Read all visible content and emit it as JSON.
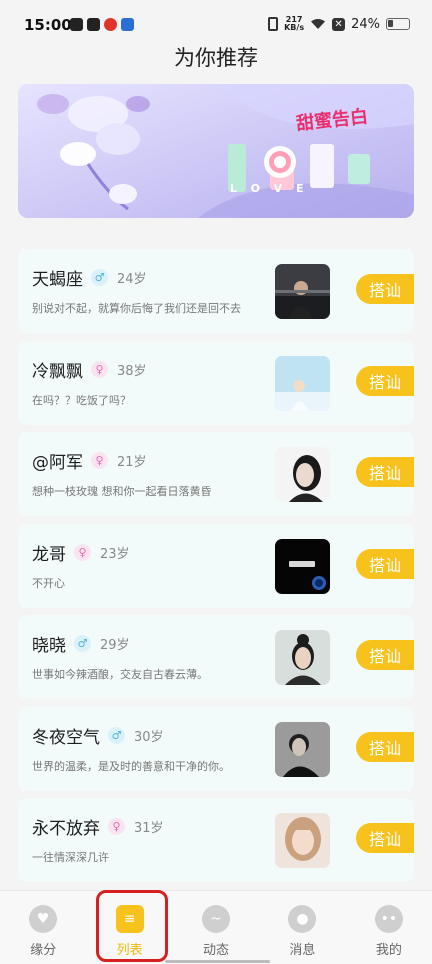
{
  "status_bar": {
    "time": "15:00",
    "net_speed_value": "217",
    "net_speed_unit": "KB/s",
    "battery": "24%"
  },
  "header": {
    "title": "为你推荐"
  },
  "banner": {
    "logo_text": "甜蜜告白",
    "letters": "LOVE"
  },
  "users": [
    {
      "name": "天蝎座",
      "gender": "male",
      "gender_symbol": "♂",
      "age": "24岁",
      "signature": "别说对不起，就算你后悔了我们还是回不去",
      "button": "搭讪"
    },
    {
      "name": "冷飘飘",
      "gender": "female",
      "gender_symbol": "♀",
      "age": "38岁",
      "signature": "在吗？？吃饭了吗？",
      "button": "搭讪"
    },
    {
      "name": "@阿军",
      "gender": "female",
      "gender_symbol": "♀",
      "age": "21岁",
      "signature": "想种一枝玫瑰 想和你一起看日落黄昏",
      "button": "搭讪"
    },
    {
      "name": "龙哥",
      "gender": "female",
      "gender_symbol": "♀",
      "age": "23岁",
      "signature": "不开心",
      "button": "搭讪"
    },
    {
      "name": "晓晓",
      "gender": "male",
      "gender_symbol": "♂",
      "age": "29岁",
      "signature": "世事如今辣酒酿，交友自古春云薄。",
      "button": "搭讪"
    },
    {
      "name": "冬夜空气",
      "gender": "male",
      "gender_symbol": "♂",
      "age": "30岁",
      "signature": "世界的温柔，是及时的善意和干净的你。",
      "button": "搭讪"
    },
    {
      "name": "永不放弃",
      "gender": "female",
      "gender_symbol": "♀",
      "age": "31岁",
      "signature": "一往情深深几许",
      "button": "搭讪"
    }
  ],
  "tabs": [
    {
      "label": "缘分",
      "icon": "heart-icon"
    },
    {
      "label": "列表",
      "icon": "list-icon"
    },
    {
      "label": "动态",
      "icon": "moments-icon"
    },
    {
      "label": "消息",
      "icon": "bell-icon"
    },
    {
      "label": "我的",
      "icon": "profile-icon"
    }
  ],
  "colors": {
    "accent": "#f6c21b",
    "card_bg": "#f2fbfa",
    "highlight": "#d62020"
  }
}
